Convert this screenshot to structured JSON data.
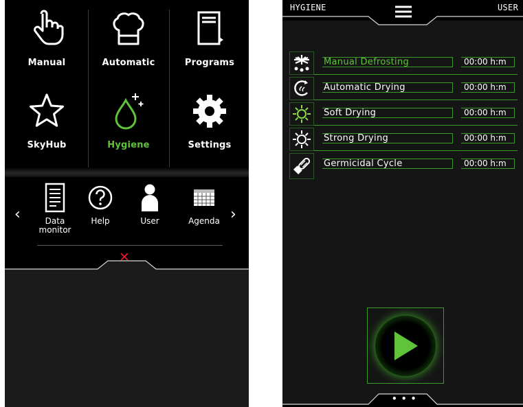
{
  "colors": {
    "accent": "#5fc43a",
    "close": "#e0162b",
    "background": "#000000"
  },
  "left_panel": {
    "tiles": [
      {
        "label": "Manual",
        "icon": "hand-pointer-icon",
        "active": false
      },
      {
        "label": "Automatic",
        "icon": "chef-hat-icon",
        "active": false
      },
      {
        "label": "Programs",
        "icon": "book-icon",
        "active": false
      },
      {
        "label": "SkyHub",
        "icon": "star-icon",
        "active": false
      },
      {
        "label": "Hygiene",
        "icon": "droplet-sparkle-icon",
        "active": true
      },
      {
        "label": "Settings",
        "icon": "gear-icon",
        "active": false
      }
    ],
    "shortcuts": [
      {
        "label": "Data\nmonitor",
        "icon": "document-icon"
      },
      {
        "label": "Help",
        "icon": "help-icon"
      },
      {
        "label": "User",
        "icon": "user-icon"
      },
      {
        "label": "Agenda",
        "icon": "calendar-icon"
      }
    ],
    "prev_arrow": "‹",
    "next_arrow": "›",
    "close_symbol": "✕"
  },
  "right_panel": {
    "header": {
      "left": "HYGIENE",
      "right": "USER"
    },
    "cycles": [
      {
        "name": "Manual Defrosting",
        "time": "00:00 h:m",
        "icon": "snowflake-icon",
        "highlight": true
      },
      {
        "name": "Automatic Drying",
        "time": "00:00 h:m",
        "icon": "auto-dry-icon",
        "highlight": false
      },
      {
        "name": "Soft Drying",
        "time": "00:00 h:m",
        "icon": "soft-sun-icon",
        "highlight": false
      },
      {
        "name": "Strong Drying",
        "time": "00:00 h:m",
        "icon": "strong-sun-icon",
        "highlight": false
      },
      {
        "name": "Germicidal Cycle",
        "time": "00:00 h:m",
        "icon": "uv-lamp-icon",
        "highlight": false
      }
    ],
    "more_symbol": "• • •"
  }
}
